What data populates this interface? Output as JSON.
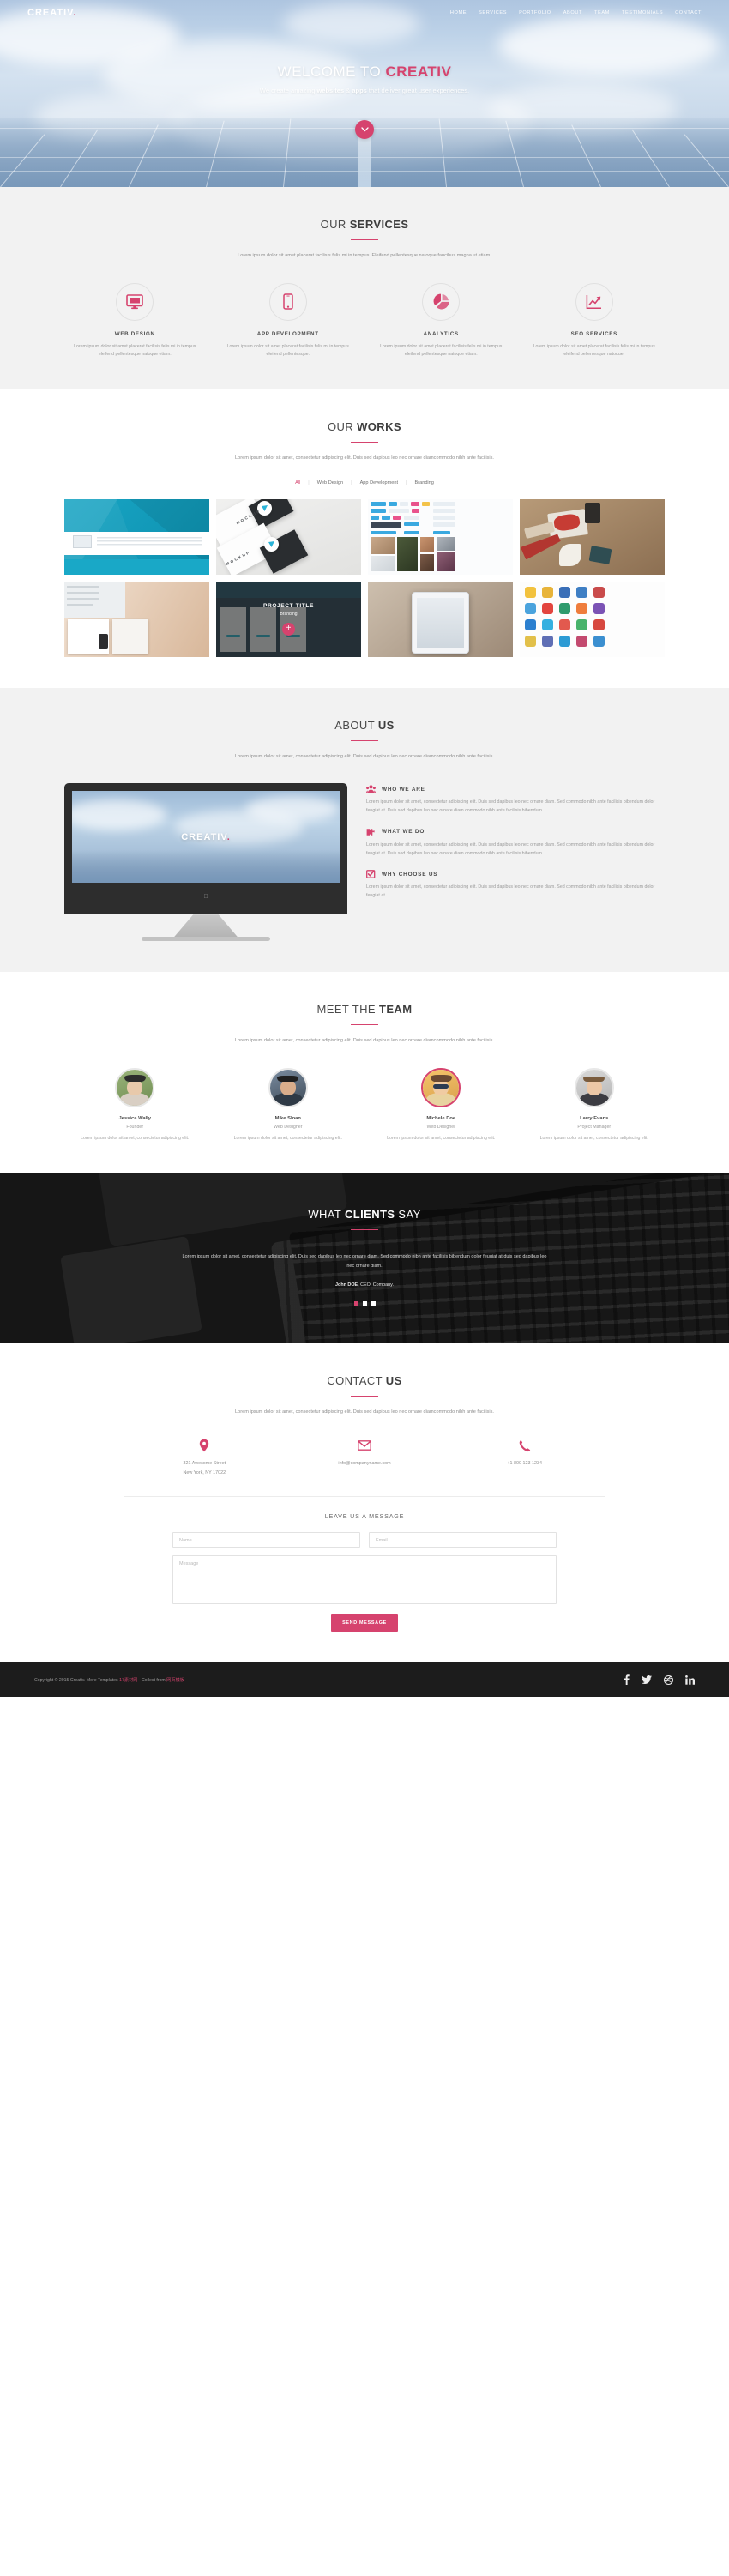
{
  "brand": {
    "name": "CREATIV",
    "dot": "."
  },
  "nav": {
    "items": [
      {
        "label": "HOME",
        "active": true
      },
      {
        "label": "SERVICES",
        "active": false
      },
      {
        "label": "PORTFOLIO",
        "active": false
      },
      {
        "label": "ABOUT",
        "active": false
      },
      {
        "label": "TEAM",
        "active": false
      },
      {
        "label": "TESTIMONIALS",
        "active": false
      },
      {
        "label": "CONTACT",
        "active": false
      }
    ]
  },
  "hero": {
    "title_light": "WELCOME TO ",
    "title_bold": "CREATIV",
    "sub_a": "We create amazing ",
    "sub_b": "websites",
    "sub_c": " & ",
    "sub_d": "apps",
    "sub_e": " that deliver great user experiences.",
    "scroll_icon": "chevron-down-icon"
  },
  "services": {
    "title_light": "OUR ",
    "title_bold": "SERVICES",
    "desc": "Lorem ipsum dolor sit amet placerat facilisis felis mi in tempus. Eleifend pellentesque natoque faucibus magna ut etiam.",
    "items": [
      {
        "icon": "monitor-icon",
        "name": "WEB DESIGN",
        "text": "Lorem ipsum dolor sit amet placerat facilisis felis mi in tempus eleifend pellentesque natoque etiam."
      },
      {
        "icon": "mobile-phone-icon",
        "name": "APP DEVELOPMENT",
        "text": "Lorem ipsum dolor sit amet placerat facilisis felis mi in tempus eleifend pellentesque."
      },
      {
        "icon": "pie-chart-icon",
        "name": "ANALYTICS",
        "text": "Lorem ipsum dolor sit amet placerat facilisis felis mi in tempus eleifend pellentesque natoque etiam."
      },
      {
        "icon": "line-chart-icon",
        "name": "SEO SERVICES",
        "text": "Lorem ipsum dolor sit amet placerat facilisis felis mi in tempus eleifend pellentesque natoque."
      }
    ]
  },
  "works": {
    "title_light": "OUR ",
    "title_bold": "WORKS",
    "desc": "Lorem ipsum dolor sit amet, consectetur adipiscing elit. Duis sed dapibus leo nec ornare diamcommodo nibh ante facilisis.",
    "filters": [
      {
        "label": "All",
        "active": true
      },
      {
        "label": "Web Design",
        "active": false
      },
      {
        "label": "App Development",
        "active": false
      },
      {
        "label": "Branding",
        "active": false
      }
    ],
    "items": [
      {
        "alt": "landing-page-mockup"
      },
      {
        "alt": "stationery-mockup"
      },
      {
        "alt": "ui-kit-elements"
      },
      {
        "alt": "desk-branding-items"
      },
      {
        "alt": "keyboard-and-books"
      },
      {
        "alt": "project-title-branding",
        "overlay_title": "PROJECT TITLE",
        "overlay_cat": "Branding",
        "overlay_icon": "plus-icon"
      },
      {
        "alt": "iphone-in-hand"
      },
      {
        "alt": "app-icon-set"
      }
    ]
  },
  "about": {
    "title_light": "ABOUT ",
    "title_bold": "US",
    "desc": "Lorem ipsum dolor sit amet, consectetur adipiscing elit. Duis sed dapibus leo nec ornare diamcommodo nibh ante facilisis.",
    "screen_label": "CREATIV",
    "screen_dot": ".",
    "items": [
      {
        "icon": "users-group-icon",
        "title": "WHO WE ARE",
        "text": "Lorem ipsum dolor sit amet, consectetur adipiscing elit. Duis sed dapibus leo nec ornare diam. Sed commodo nibh ante facilisis bibendum dolor feugiat at. Duis sed dapibus leo nec ornare diam commodo nibh ante facilisis bibendum."
      },
      {
        "icon": "puzzle-piece-icon",
        "title": "WHAT WE DO",
        "text": "Lorem ipsum dolor sit amet, consectetur adipiscing elit. Duis sed dapibus leo nec ornare diam. Sed commodo nibh ante facilisis bibendum dolor feugiat at. Duis sed dapibus leo nec ornare diam commodo nibh ante facilisis bibendum."
      },
      {
        "icon": "checkbox-check-icon",
        "title": "WHY CHOOSE US",
        "text": "Lorem ipsum dolor sit amet, consectetur adipiscing elit. Duis sed dapibus leo nec ornare diam. Sed commodo nibh ante facilisis bibendum dolor feugiat at."
      }
    ]
  },
  "team": {
    "title_light": "MEET THE ",
    "title_bold": "TEAM",
    "desc": "Lorem ipsum dolor sit amet, consectetur adipiscing elit. Duis sed dapibus leo nec ornare diamcommodo nibh ante facilisis.",
    "members": [
      {
        "name": "Jessica Wally",
        "role": "Founder",
        "text": "Lorem ipsum dolor sit amet, consectetur adipiscing elit.",
        "highlight": false
      },
      {
        "name": "Mike Sloan",
        "role": "Web Designer",
        "text": "Lorem ipsum dolor sit amet, consectetur adipiscing elit.",
        "highlight": false
      },
      {
        "name": "Michele Doe",
        "role": "Web Designer",
        "text": "Lorem ipsum dolor sit amet, consectetur adipiscing elit.",
        "highlight": true
      },
      {
        "name": "Larry Evans",
        "role": "Project Manager",
        "text": "Lorem ipsum dolor sit amet, consectetur adipiscing elit.",
        "highlight": false
      }
    ]
  },
  "testimonials": {
    "title_light": "WHAT ",
    "title_bold": "CLIENTS",
    "title_tail": " SAY",
    "quote": "Lorem ipsum dolor sit amet, consectetur adipiscing elit. Duis sed dapibus leo nec ornare diam. Sed commodo nibh ante facilisis bibendum dolor feugiat at duis sed dapibus leo nec ornare diam.",
    "author_bold": "John DOE",
    "author_rest": ", CEO, Company.",
    "dots": 3,
    "active_dot": 0
  },
  "contact": {
    "title_light": "CONTACT ",
    "title_bold": "US",
    "desc": "Lorem ipsum dolor sit amet, consectetur adipiscing elit. Duis sed dapibus leo nec ornare diamcommodo nibh ante facilisis.",
    "cells": [
      {
        "icon": "map-pin-icon",
        "line1": "321 Awesome Street",
        "line2": "New York, NY 17022"
      },
      {
        "icon": "envelope-icon",
        "line1": "info@companyname.com",
        "line2": ""
      },
      {
        "icon": "phone-icon",
        "line1": "+1 800 123 1234",
        "line2": ""
      }
    ],
    "form_title": "LEAVE US A MESSAGE",
    "name_placeholder": "Name",
    "email_placeholder": "Email",
    "message_placeholder": "Message",
    "send_label": "SEND MESSAGE"
  },
  "footer": {
    "copyright_a": "Copyright © 2015 Creativ. More Templates ",
    "link_a": "17素材网",
    "copyright_b": " - Collect from ",
    "link_b": "网页模板",
    "social": [
      {
        "icon": "facebook-icon",
        "glyph": "f"
      },
      {
        "icon": "twitter-icon",
        "glyph": "🐦"
      },
      {
        "icon": "dribbble-icon",
        "glyph": "●"
      },
      {
        "icon": "linkedin-icon",
        "glyph": "in"
      }
    ]
  },
  "colors": {
    "accent": "#d6436e",
    "dark": "#1c1c1c",
    "grey_bg": "#f2f2f2"
  }
}
